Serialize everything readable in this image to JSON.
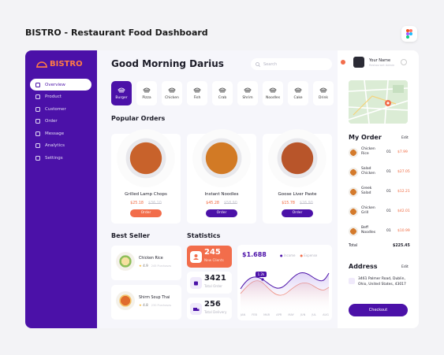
{
  "page_title": "BISTRO - Restaurant Food Dashboard",
  "brand": "BISTRO",
  "sidebar": {
    "items": [
      {
        "label": "Overview",
        "active": true
      },
      {
        "label": "Product"
      },
      {
        "label": "Customer"
      },
      {
        "label": "Order"
      },
      {
        "label": "Message"
      },
      {
        "label": "Analytics"
      },
      {
        "label": "Settings"
      }
    ]
  },
  "header": {
    "greeting": "Good Morning Darius",
    "search_placeholder": "Search"
  },
  "categories": [
    "Burger",
    "Pizza",
    "Chicken",
    "Fish",
    "Crab",
    "Shrim",
    "Noodles",
    "Cake",
    "Drink"
  ],
  "popular": {
    "title": "Popular Orders",
    "items": [
      {
        "name": "Grilled Lamp Chops",
        "price": "$25.18",
        "old_price": "$36.10",
        "button": "Order"
      },
      {
        "name": "Instant Noodles",
        "price": "$45.28",
        "old_price": "$58.90",
        "button": "Order"
      },
      {
        "name": "Goose Liver Paste",
        "price": "$15.78",
        "old_price": "$26.90",
        "button": "Order"
      }
    ]
  },
  "best_seller": {
    "title": "Best Seller",
    "items": [
      {
        "name": "Chicken Rice",
        "rating": "4.9",
        "note": "245 Purchases"
      },
      {
        "name": "Shirm Soup Thai",
        "rating": "4.8",
        "note": "230 Purchases"
      }
    ]
  },
  "statistics": {
    "title": "Statistics",
    "cards": [
      {
        "value": "245",
        "label": "New Clients"
      },
      {
        "value": "3421",
        "label": "Total Order"
      },
      {
        "value": "256",
        "label": "Total Delivery"
      }
    ],
    "chart": {
      "total": "$1.688",
      "legend": [
        "Income",
        "Expense"
      ],
      "tooltip": "1.2k",
      "months": [
        "JAN",
        "FEB",
        "MAR",
        "APR",
        "MAY",
        "JUN",
        "JUL",
        "AUG"
      ]
    }
  },
  "profile": {
    "name": "Your Name",
    "sub": "Restaurant Admin"
  },
  "my_order": {
    "title": "My Order",
    "edit": "Edit",
    "items": [
      {
        "name": "Chicken Rice",
        "qty": "01",
        "price": "$7.99"
      },
      {
        "name": "Salad Chicken",
        "qty": "01",
        "price": "$27.05"
      },
      {
        "name": "Greek Salad",
        "qty": "01",
        "price": "$12.21"
      },
      {
        "name": "Chicken Grill",
        "qty": "01",
        "price": "$42.01"
      },
      {
        "name": "Beff Noodles",
        "qty": "01",
        "price": "$10.99"
      }
    ],
    "total_label": "Total",
    "total": "$225.45"
  },
  "address": {
    "title": "Address",
    "edit": "Edit",
    "text": "3461 Palmer Road, Dublin, Ohio, United States, 43017"
  },
  "checkout": "Checkout"
}
